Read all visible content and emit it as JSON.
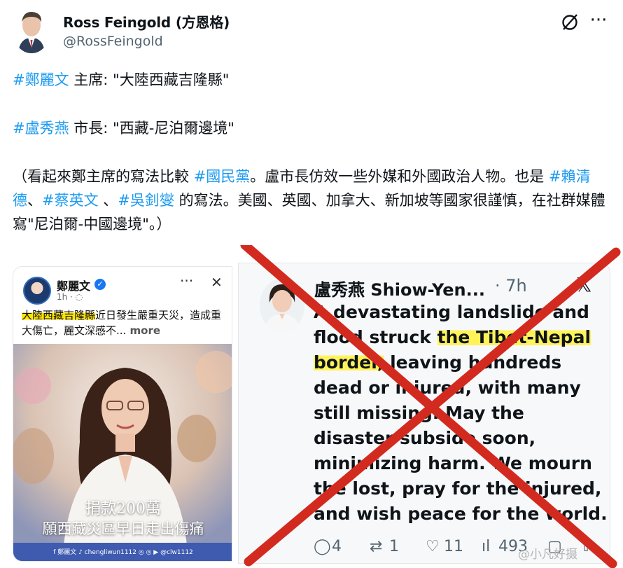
{
  "author": {
    "name": "Ross Feingold (方恩格)",
    "handle": "@RossFeingold"
  },
  "tweet": {
    "line1": {
      "tag": "#鄭麗文",
      "rest": " 主席: \"大陸西藏吉隆縣\""
    },
    "line2": {
      "tag": "#盧秀燕",
      "rest": " 市長: \"西藏-尼泊爾邊境\""
    },
    "para": {
      "p1": "（看起來鄭主席的寫法比較 ",
      "tag1": "#國民黨",
      "p2": "。盧市長仿效一些外媒和外國政治人物。也是 ",
      "tag2": "#賴清德",
      "p3": "、",
      "tag3": "#蔡英文",
      "p4": " 、",
      "tag4": "#吳釗燮",
      "p5": " 的寫法。美國、英國、加拿大、新加坡等國家很謹慎，在社群媒體寫\"尼泊爾-中國邊境\"。）"
    }
  },
  "fb_post": {
    "name": "鄭麗文",
    "meta": "1h · ",
    "highlight": "大陸西藏吉隆縣",
    "text_rest": "近日發生嚴重天災，造成重大傷亡，麗文深感不...",
    "more": " more",
    "caption_l1": "捐款200萬",
    "caption_l2": "願西藏災區早日走出傷痛",
    "footer": "f 鄭麗文   ♪ chengliwun1112   ◎ ◎ ▶ @clw1112"
  },
  "inner_tweet": {
    "name": "盧秀燕 Shiow-Yen...",
    "time": "· 7h",
    "text_a": "A devastating landslide and flood struck ",
    "text_hl1": "the Tibet-Nepal",
    "text_sp": " ",
    "text_hl2": "border,",
    "text_b": " leaving hundreds dead or injured, with many still missing. May the disaster subside soon, minimizing harm. We mourn the lost, pray for the injured, and wish peace for the world.",
    "replies": "4",
    "retweets": "1",
    "likes": "11",
    "views": "493"
  },
  "watermark": "@小凡好摄",
  "colors": {
    "link": "#1d9bf0",
    "cross": "#d32a1f",
    "highlight": "#fff35a"
  }
}
